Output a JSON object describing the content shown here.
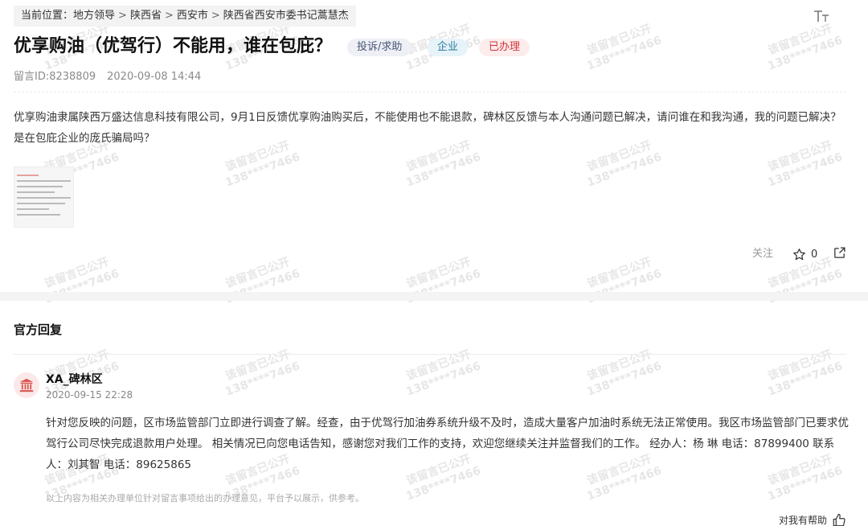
{
  "breadcrumb": {
    "prefix": "当前位置：",
    "items": [
      "地方领导",
      "陕西省",
      "西安市",
      "陕西省西安市委书记蒿慧杰"
    ],
    "separator": ">"
  },
  "post": {
    "title": "优享购油（优驾行）不能用，谁在包庇？",
    "tags": {
      "type": "投诉/求助",
      "entity": "企业",
      "status": "已办理"
    },
    "id_label": "留言ID:8238809",
    "datetime": "2020-09-08 14:44",
    "content": "优享购油隶属陕西万盛达信息科技有限公司，9月1日反馈优享购油购买后，不能使用也不能退款，碑林区反馈与本人沟通问题已解决，请问谁在和我沟通，我的问题已解决？是在包庇企业的庞氏骗局吗？",
    "follow_label": "关注",
    "star_count": "0"
  },
  "reply": {
    "heading": "官方回复",
    "department": "XA_碑林区",
    "datetime": "2020-09-15 22:28",
    "content": "针对您反映的问题，区市场监管部门立即进行调查了解。经查，由于优驾行加油券系统升级不及时，造成大量客户加油时系统无法正常使用。我区市场监管部门已要求优驾行公司尽快完成退款用户处理。 相关情况已向您电话告知，感谢您对我们工作的支持，欢迎您继续关注并监督我们的工作。 经办人：杨 琳 电话：87899400 联系人：刘其智 电话：89625865",
    "disclaimer": "以上内容为相关办理单位针对留言事项给出的办理意见，平台予以展示，供参考。",
    "helpful_label": "对我有帮助"
  },
  "watermark": {
    "line1": "该留言已公开",
    "line2": "138****7466"
  },
  "icons": {
    "font_size": "font-size-icon",
    "star": "star-icon",
    "share": "share-icon",
    "avatar": "government-building-icon",
    "thumb": "thumbs-up-icon"
  },
  "colors": {
    "status_red": "#d0353b",
    "entity_blue": "#2b7a9e",
    "type_gray": "#4a5577",
    "avatar_red": "#d9534f"
  }
}
